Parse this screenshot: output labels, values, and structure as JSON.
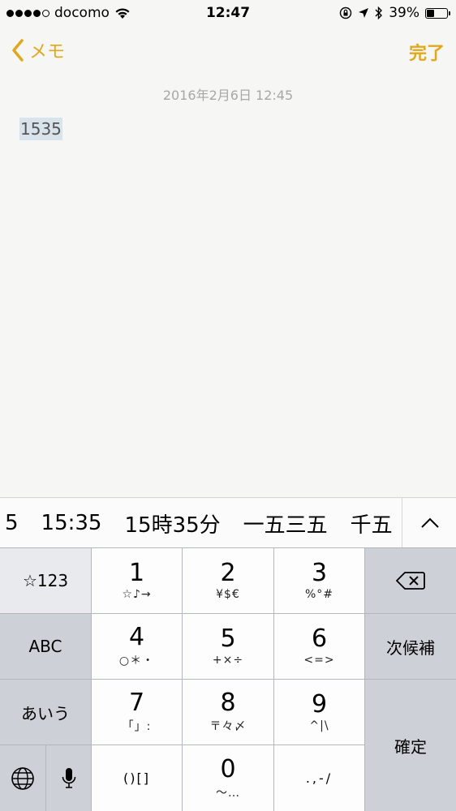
{
  "status": {
    "carrier": "docomo",
    "time": "12:47",
    "battery": "39%",
    "battery_level": 0.39
  },
  "nav": {
    "back_label": "メモ",
    "done_label": "完了",
    "accent": "#e2a81d"
  },
  "note": {
    "date": "2016年2月6日 12:45",
    "text": "1535"
  },
  "candidates": [
    "5",
    "15:35",
    "15時35分",
    "一五三五",
    "千五"
  ],
  "keyboard": {
    "fn_label": "☆123",
    "abc_label": "ABC",
    "kana_label": "あいう",
    "next_candidate_label": "次候補",
    "confirm_label": "確定",
    "keys": [
      {
        "num": "1",
        "sub": "☆♪→"
      },
      {
        "num": "2",
        "sub": "¥$€"
      },
      {
        "num": "3",
        "sub": "%°#"
      },
      {
        "num": "4",
        "sub": "○＊・"
      },
      {
        "num": "5",
        "sub": "+×÷"
      },
      {
        "num": "6",
        "sub": "<=>"
      },
      {
        "num": "7",
        "sub": "「」:"
      },
      {
        "num": "8",
        "sub": "〒々〆"
      },
      {
        "num": "9",
        "sub": "^|\\"
      },
      {
        "num": "",
        "sub": "()[]"
      },
      {
        "num": "0",
        "sub": "〜…"
      },
      {
        "num": "",
        "sub": ".,-/"
      }
    ]
  }
}
